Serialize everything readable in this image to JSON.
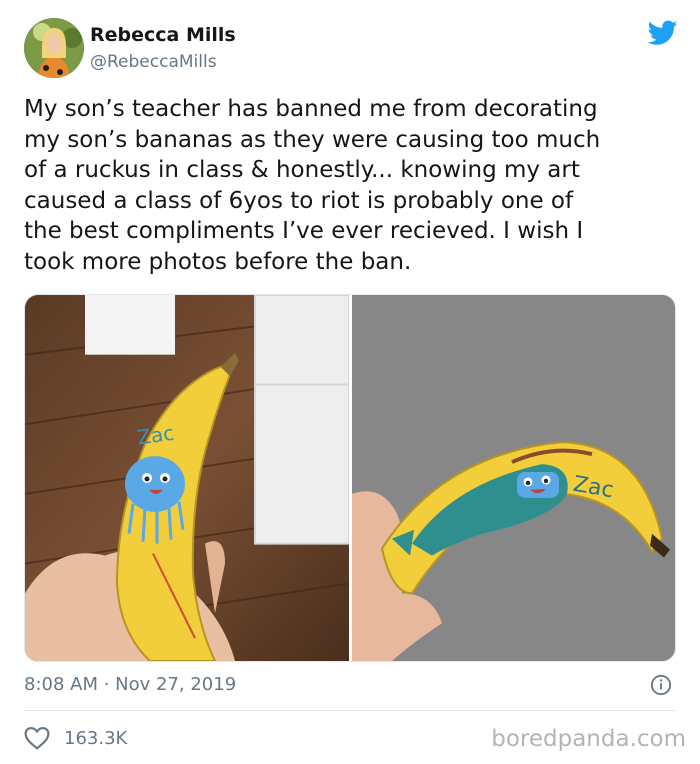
{
  "user": {
    "name": "Rebecca Mills",
    "handle": "@RebeccaMills"
  },
  "tweet": {
    "lines": [
      "My son’s teacher has banned me from decorating",
      "my son’s bananas as they were causing too much",
      "of a ruckus in class & honestly... knowing my art",
      "caused a class of 6yos to riot is probably one of",
      "the best compliments I’ve ever recieved. I wish I",
      "took more photos before the ban."
    ],
    "timestamp": "8:08 AM · Nov 27, 2019",
    "likes": "163.3K"
  },
  "media": {
    "left_banana_label": "Zac",
    "right_banana_label": "Zac"
  },
  "watermark": "boredpanda.com",
  "colors": {
    "twitter_blue": "#1da1f2",
    "banana_yellow": "#f2cf3a",
    "doodle_blue": "#5aa9e6",
    "doodle_teal": "#2f8f8f",
    "muted_gray": "#657786"
  },
  "icons": {
    "brand": "twitter-bird-icon",
    "info": "info-icon",
    "like": "heart-icon"
  }
}
